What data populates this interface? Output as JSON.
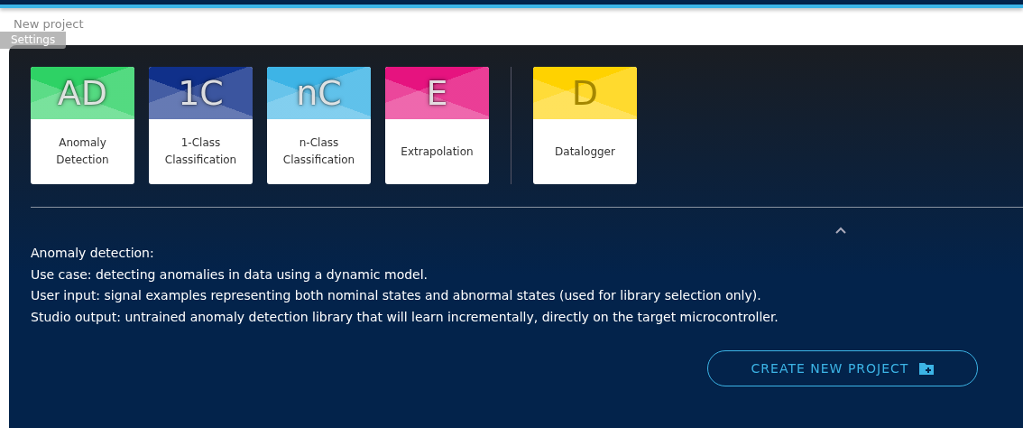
{
  "breadcrumb": "New project",
  "tooltip": "Settings",
  "project_types": [
    {
      "abbr": "AD",
      "label": "Anomaly Detection",
      "color": "#2ed265",
      "kind": "model"
    },
    {
      "abbr": "1C",
      "label": "1-Class Classification",
      "color": "#10308a",
      "kind": "model"
    },
    {
      "abbr": "nC",
      "label": "n-Class Classification",
      "color": "#3db4e6",
      "kind": "model"
    },
    {
      "abbr": "E",
      "label": "Extrapolation",
      "color": "#e6137f",
      "kind": "model"
    },
    {
      "abbr": "D",
      "label": "Datalogger",
      "color": "#ffd200",
      "kind": "logger"
    }
  ],
  "description": [
    "Anomaly detection:",
    "Use case: detecting anomalies in data using a dynamic model.",
    "User input: signal examples representing both nominal states and abnormal states (used for library selection only).",
    "Studio output: untrained anomaly detection library that will learn incrementally, directly on the target microcontroller."
  ],
  "create_button": "CREATE NEW PROJECT"
}
